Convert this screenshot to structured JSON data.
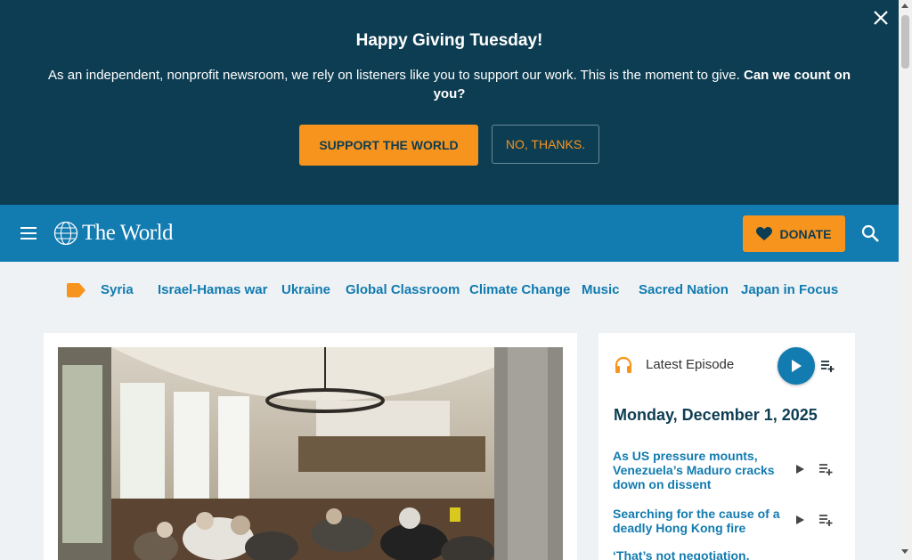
{
  "banner": {
    "title": "Happy Giving Tuesday!",
    "text": "As an independent, nonprofit newsroom, we rely on listeners like you to support our work. This is the moment to give.",
    "text_bold": "Can we count on you?",
    "support_label": "SUPPORT THE WORLD",
    "no_label": "NO, THANKS."
  },
  "header": {
    "logo_text": "The World",
    "donate_label": "DONATE"
  },
  "topics": [
    "Syria",
    "Israel-Hamas war",
    "Ukraine",
    "Global Classroom",
    "Climate Change",
    "Music",
    "Sacred Nation",
    "Japan in Focus"
  ],
  "sidebar": {
    "latest_label": "Latest Episode",
    "date": "Monday, December 1, 2025",
    "episodes": [
      {
        "title": "As US pressure mounts, Venezuela’s Maduro cracks down on dissent"
      },
      {
        "title": "Searching for the cause of a deadly Hong Kong fire"
      },
      {
        "title": "‘That’s not negotiation,"
      }
    ]
  },
  "colors": {
    "banner_bg": "#0d3d52",
    "header_bg": "#127bb0",
    "accent": "#f7941d"
  }
}
